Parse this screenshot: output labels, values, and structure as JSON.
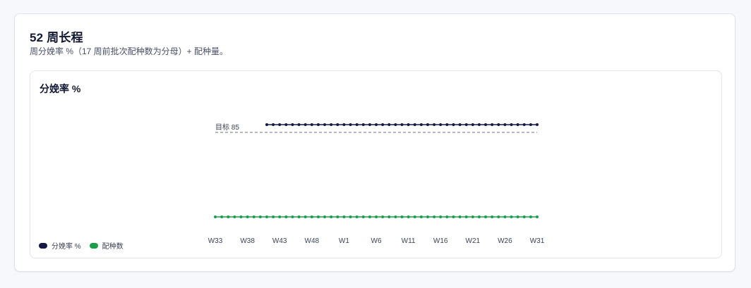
{
  "card": {
    "title": "52 周长程",
    "subtitle": "周分娩率 %（17 周前批次配种数为分母）+ 配种量。"
  },
  "chart_data": {
    "type": "line",
    "title": "分娩率 %",
    "x": [
      "W33",
      "W34",
      "W35",
      "W36",
      "W37",
      "W38",
      "W39",
      "W40",
      "W41",
      "W42",
      "W43",
      "W44",
      "W45",
      "W46",
      "W47",
      "W48",
      "W49",
      "W50",
      "W51",
      "W52",
      "W1",
      "W2",
      "W3",
      "W4",
      "W5",
      "W6",
      "W7",
      "W8",
      "W9",
      "W10",
      "W11",
      "W12",
      "W13",
      "W14",
      "W15",
      "W16",
      "W17",
      "W18",
      "W19",
      "W20",
      "W21",
      "W22",
      "W23",
      "W24",
      "W25",
      "W26",
      "W27",
      "W28",
      "W29",
      "W30",
      "W31"
    ],
    "x_tick_labels": [
      "W33",
      "W38",
      "W43",
      "W48",
      "W1",
      "W6",
      "W11",
      "W16",
      "W21",
      "W26",
      "W31"
    ],
    "series": [
      {
        "name": "分娩率 %",
        "color": "#141a45",
        "values": [
          null,
          null,
          null,
          null,
          null,
          null,
          null,
          null,
          1,
          1,
          1,
          1,
          1,
          1,
          1,
          1,
          1,
          1,
          1,
          1,
          1,
          1,
          1,
          1,
          1,
          1,
          1,
          1,
          1,
          1,
          1,
          1,
          1,
          1,
          1,
          1,
          1,
          1,
          1,
          1,
          1,
          1,
          1,
          1,
          1,
          1,
          1,
          1,
          1,
          1,
          1
        ]
      },
      {
        "name": "配种数",
        "color": "#1a9e4b",
        "values": [
          1,
          1,
          1,
          1,
          1,
          1,
          1,
          1,
          1,
          1,
          1,
          1,
          1,
          1,
          1,
          1,
          1,
          1,
          1,
          1,
          1,
          1,
          1,
          1,
          1,
          1,
          1,
          1,
          1,
          1,
          1,
          1,
          1,
          1,
          1,
          1,
          1,
          1,
          1,
          1,
          1,
          1,
          1,
          1,
          1,
          1,
          1,
          1,
          1,
          1,
          1
        ]
      }
    ],
    "reference_line": {
      "label": "目标 85",
      "value": 85,
      "style": "dashed",
      "color": "#6b7080"
    },
    "grid": false,
    "legend_position": "bottom-left"
  }
}
